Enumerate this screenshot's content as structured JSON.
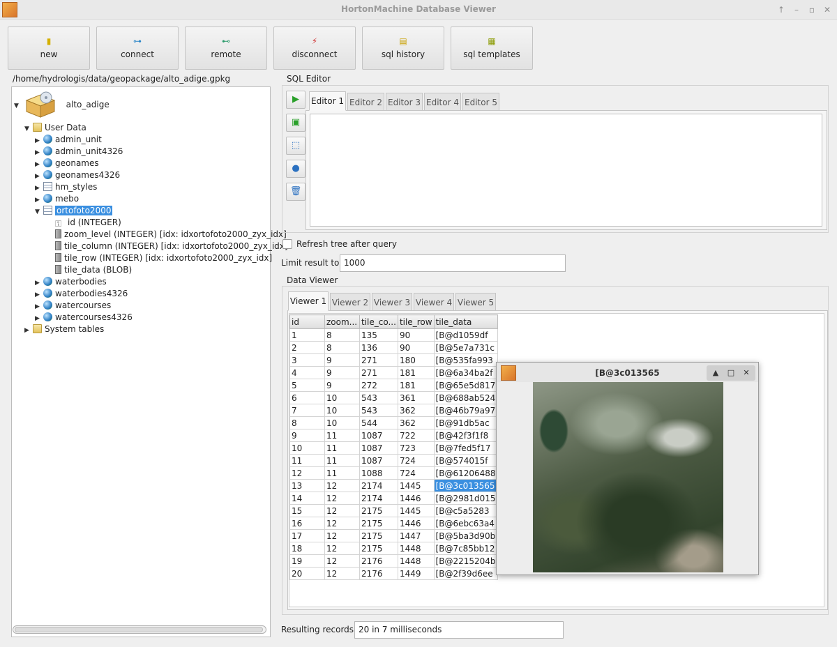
{
  "window": {
    "title": "HortonMachine Database Viewer"
  },
  "toolbar": [
    {
      "label": "new",
      "icon": "new-db-icon",
      "color": "#d4b000"
    },
    {
      "label": "connect",
      "icon": "connect-icon",
      "color": "#2a86c8"
    },
    {
      "label": "remote",
      "icon": "remote-icon",
      "color": "#2a9a6a"
    },
    {
      "label": "disconnect",
      "icon": "disconnect-icon",
      "color": "#d03030"
    },
    {
      "label": "sql history",
      "icon": "history-icon",
      "color": "#c8a000"
    },
    {
      "label": "sql templates",
      "icon": "templates-icon",
      "color": "#8a9a00"
    }
  ],
  "db_path": "/home/hydrologis/data/geopackage/alto_adige.gpkg",
  "tree": {
    "root": "alto_adige",
    "items": [
      {
        "label": "User Data",
        "expanded": true,
        "icon": "folder"
      },
      {
        "label": "admin_unit",
        "icon": "globe"
      },
      {
        "label": "admin_unit4326",
        "icon": "globe"
      },
      {
        "label": "geonames",
        "icon": "globe"
      },
      {
        "label": "geonames4326",
        "icon": "globe"
      },
      {
        "label": "hm_styles",
        "icon": "table"
      },
      {
        "label": "mebo",
        "icon": "globe"
      },
      {
        "label": "ortofoto2000",
        "icon": "table",
        "selected": true,
        "expanded": true
      },
      {
        "label": "id (INTEGER)",
        "icon": "key"
      },
      {
        "label": "zoom_level (INTEGER) [idx: idxortofoto2000_zyx_idx]",
        "icon": "col"
      },
      {
        "label": "tile_column (INTEGER) [idx: idxortofoto2000_zyx_idx]",
        "icon": "col"
      },
      {
        "label": "tile_row (INTEGER) [idx: idxortofoto2000_zyx_idx]",
        "icon": "col"
      },
      {
        "label": "tile_data (BLOB)",
        "icon": "col"
      },
      {
        "label": "waterbodies",
        "icon": "globe"
      },
      {
        "label": "waterbodies4326",
        "icon": "globe"
      },
      {
        "label": "watercourses",
        "icon": "globe"
      },
      {
        "label": "watercourses4326",
        "icon": "globe"
      },
      {
        "label": "System tables",
        "icon": "folder"
      }
    ]
  },
  "sql_editor": {
    "group_label": "SQL Editor",
    "tabs": [
      "Editor 1",
      "Editor 2",
      "Editor 3",
      "Editor 4",
      "Editor 5"
    ],
    "active_tab": "Editor 1",
    "buttons": [
      "run-query-icon",
      "run-to-file-icon",
      "select-icon",
      "geometry-view-icon",
      "clear-icon"
    ],
    "text": ""
  },
  "refresh_label": "Refresh tree after query",
  "limit_label": "Limit result to",
  "limit_value": "1000",
  "data_viewer": {
    "group_label": "Data Viewer",
    "tabs": [
      "Viewer 1",
      "Viewer 2",
      "Viewer 3",
      "Viewer 4",
      "Viewer 5"
    ],
    "active_tab": "Viewer 1",
    "columns": [
      "id",
      "zoom...",
      "tile_co...",
      "tile_row",
      "tile_data"
    ],
    "rows": [
      [
        "1",
        "8",
        "135",
        "90",
        "[B@d1059df"
      ],
      [
        "2",
        "8",
        "136",
        "90",
        "[B@5e7a731c"
      ],
      [
        "3",
        "9",
        "271",
        "180",
        "[B@535fa993"
      ],
      [
        "4",
        "9",
        "271",
        "181",
        "[B@6a34ba2f"
      ],
      [
        "5",
        "9",
        "272",
        "181",
        "[B@65e5d817"
      ],
      [
        "6",
        "10",
        "543",
        "361",
        "[B@688ab524"
      ],
      [
        "7",
        "10",
        "543",
        "362",
        "[B@46b79a97"
      ],
      [
        "8",
        "10",
        "544",
        "362",
        "[B@91db5ac"
      ],
      [
        "9",
        "11",
        "1087",
        "722",
        "[B@42f3f1f8"
      ],
      [
        "10",
        "11",
        "1087",
        "723",
        "[B@7fed5f17"
      ],
      [
        "11",
        "11",
        "1087",
        "724",
        "[B@574015f"
      ],
      [
        "12",
        "11",
        "1088",
        "724",
        "[B@61206488"
      ],
      [
        "13",
        "12",
        "2174",
        "1445",
        "[B@3c013565"
      ],
      [
        "14",
        "12",
        "2174",
        "1446",
        "[B@2981d015"
      ],
      [
        "15",
        "12",
        "2175",
        "1445",
        "[B@c5a5283"
      ],
      [
        "16",
        "12",
        "2175",
        "1446",
        "[B@6ebc63a4"
      ],
      [
        "17",
        "12",
        "2175",
        "1447",
        "[B@5ba3d90b"
      ],
      [
        "18",
        "12",
        "2175",
        "1448",
        "[B@7c85bb12"
      ],
      [
        "19",
        "12",
        "2176",
        "1448",
        "[B@2215204b"
      ],
      [
        "20",
        "12",
        "2176",
        "1449",
        "[B@2f39d6ee"
      ]
    ],
    "selected_cell": {
      "row": 12,
      "col": 4
    }
  },
  "result_label": "Resulting records",
  "result_value": "20 in 7 milliseconds",
  "popup": {
    "title": "[B@3c013565"
  },
  "colors": {
    "selection": "#3a8fe0"
  }
}
